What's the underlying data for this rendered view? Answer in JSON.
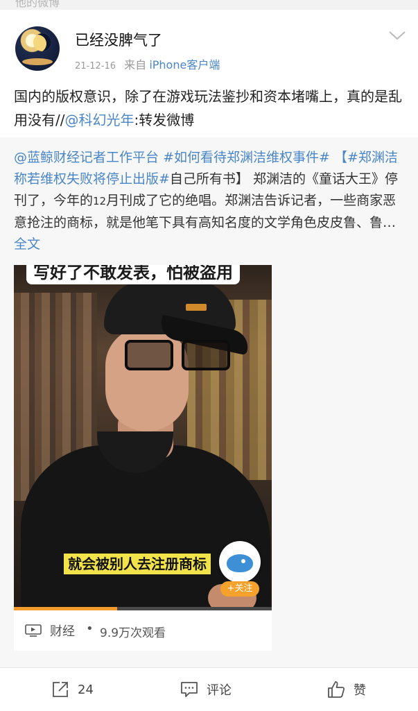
{
  "status_bar": {
    "partial_text": "他的微博"
  },
  "post": {
    "username": "已经没脾气了",
    "date": "21-12-16",
    "from_label": "来自",
    "client": "iPhone客户端",
    "text_main": "国内的版权意识，除了在游戏玩法鉴抄和资本堵嘴上，真的是乱用没有//",
    "mention": "@科幻光年",
    "text_tail": ":转发微博"
  },
  "repost": {
    "author": "@蓝鲸财经记者工作平台",
    "topic1": "#如何看待郑渊洁维权事件#",
    "bracket_open": "【",
    "topic2": "#郑渊洁称若维权失败将停止出版#",
    "line2_tail": "自己所有书】",
    "body_a": "郑渊洁的《童话大王》停刊了，今年的",
    "body_num": "12",
    "body_b": "月刊成了它的绝唱。郑渊洁告诉记者，一些商家恶意抢注的商标，就是他笔下具有高知名度的文学角色皮皮鲁、鲁…",
    "full_text_link": "全文"
  },
  "video": {
    "caption_top": "写好了不敢发表，怕被盗用",
    "caption_bottom": "就会被别人去注册商标",
    "follow_label": "+关注",
    "progress": 0.4,
    "category": "财经",
    "separator": "•",
    "views": "9.9万次观看"
  },
  "actions": {
    "repost_count": "24",
    "comment_label": "评论",
    "like_label": "赞"
  },
  "colors": {
    "link": "#4a86c7",
    "progress": "#f39c2b",
    "follow": "#f4a22b"
  }
}
